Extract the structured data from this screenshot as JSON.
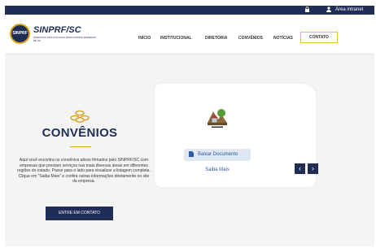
{
  "topbar": {
    "lock_icon": "lock-icon",
    "user_icon": "user-icon",
    "intranet_label": "Área intranet",
    "background": "#1f2d57"
  },
  "header": {
    "logo_text": "SINPRF",
    "brand": "SINPRF/SC",
    "brand_sub": "SINDICATO DOS POLICIAIS RODOVIÁRIOS FEDERAIS DE SC",
    "nav": [
      "INÍCIO",
      "INSTITUCIONAL",
      "DIRETORIA",
      "CONVÊNIOS",
      "NOTÍCIAS",
      "CONTATO"
    ]
  },
  "main": {
    "coins_icon": "coins-icon",
    "title": "CONVÊNIOS",
    "description": "Aqui você encontra os convênios ativos firmados pelo SINPRF/SC com empresas que prestam serviços nas mais diversas áreas em diferentes regiões do estado. Passe para o lado para visualizar a listagem completa. Clique em \"Saiba Mais\" e confira outras informações diretamente no site da empresa.",
    "cta": "ENTRE EM CONTATO"
  },
  "card": {
    "partner_logo": "partner-logo",
    "download": "Baixar Documento",
    "saiba_mais": "Saiba Mais"
  },
  "carousel": {
    "prev": "‹",
    "next": "›"
  },
  "colors": {
    "primary": "#1f2d57",
    "accent": "#d9a21b",
    "link": "#2b5aa6"
  }
}
